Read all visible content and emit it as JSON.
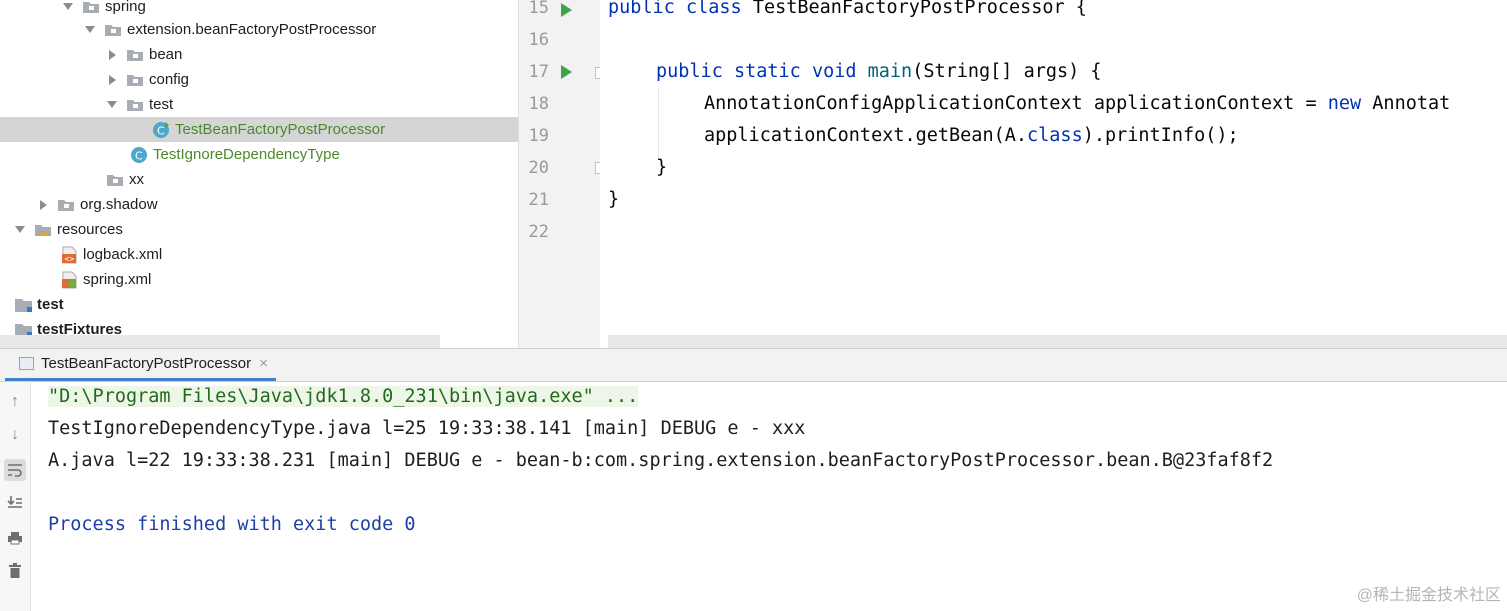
{
  "tree": {
    "items": [
      {
        "label": "spring",
        "expanded": true,
        "icon": "package-folder-icon"
      },
      {
        "label": "extension.beanFactoryPostProcessor",
        "expanded": true,
        "icon": "package-folder-icon"
      },
      {
        "label": "bean",
        "expanded": false,
        "icon": "package-folder-icon"
      },
      {
        "label": "config",
        "expanded": false,
        "icon": "package-folder-icon"
      },
      {
        "label": "test",
        "expanded": true,
        "icon": "package-folder-icon"
      },
      {
        "label": "TestBeanFactoryPostProcessor",
        "icon": "java-class-run-icon",
        "selected": true
      },
      {
        "label": "TestIgnoreDependencyType",
        "icon": "java-class-icon"
      },
      {
        "label": "xx",
        "icon": "package-folder-icon"
      },
      {
        "label": "org.shadow",
        "expanded": false,
        "icon": "package-folder-icon"
      },
      {
        "label": "resources",
        "expanded": true,
        "icon": "resources-folder-icon"
      },
      {
        "label": "logback.xml",
        "icon": "xml-file-icon"
      },
      {
        "label": "spring.xml",
        "icon": "spring-xml-file-icon"
      },
      {
        "label": "test",
        "icon": "module-folder-icon"
      },
      {
        "label": "testFixtures",
        "icon": "module-folder-icon"
      }
    ]
  },
  "editor": {
    "line_numbers": [
      "15",
      "16",
      "17",
      "18",
      "19",
      "20",
      "21",
      "22"
    ],
    "lines": {
      "l15": {
        "kw1": "public",
        "kw2": "class",
        "rest": " TestBeanFactoryPostProcessor {"
      },
      "l17": {
        "kw1": "public",
        "kw2": "static",
        "kw3": "void",
        "method": "main",
        "rest": "(String[] args) {"
      },
      "l18": {
        "text": "AnnotationConfigApplicationContext applicationContext = ",
        "kw": "new",
        "rest": " Annotat"
      },
      "l19": {
        "pre": "applicationContext.getBean(A.",
        "kw": "class",
        "rest": ").printInfo();"
      },
      "l20": {
        "text": "}"
      },
      "l21": {
        "text": "}"
      }
    }
  },
  "run": {
    "tab_label": "TestBeanFactoryPostProcessor",
    "console_lines": [
      "\"D:\\Program Files\\Java\\jdk1.8.0_231\\bin\\java.exe\" ...",
      "TestIgnoreDependencyType.java l=25 19:33:38.141 [main] DEBUG e - xxx",
      "A.java l=22 19:33:38.231 [main] DEBUG e - bean-b:com.spring.extension.beanFactoryPostProcessor.bean.B@23faf8f2",
      "Process finished with exit code 0"
    ],
    "toolbar_icons": [
      "arrow-up-icon",
      "arrow-down-icon",
      "soft-wrap-icon",
      "scroll-to-end-icon",
      "print-icon",
      "trash-icon"
    ]
  },
  "watermark": "@稀土掘金技术社区",
  "colors": {
    "keyword": "#0033b3",
    "run_green": "#3fa34d",
    "selected_row": "#d5d5d5",
    "tab_accent": "#4083c9"
  }
}
